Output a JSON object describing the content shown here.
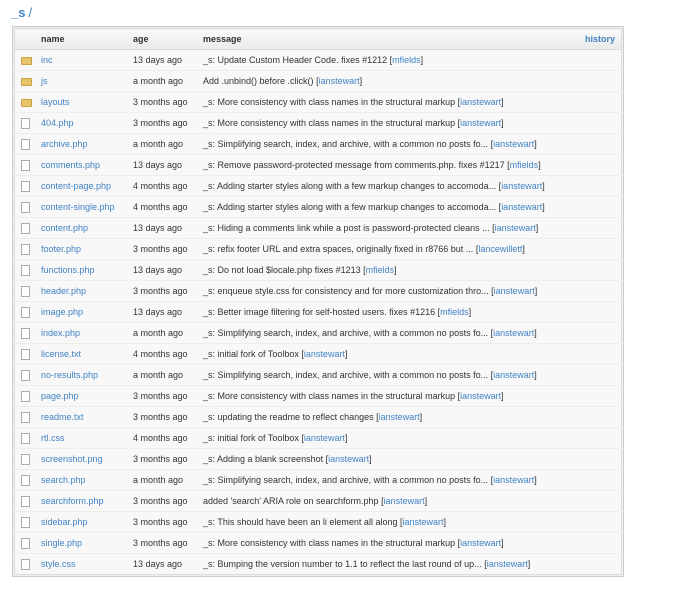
{
  "breadcrumb": {
    "repo": "_s",
    "sep": "/"
  },
  "header": {
    "name": "name",
    "age": "age",
    "message": "message",
    "history": "history"
  },
  "rows": [
    {
      "type": "folder",
      "name": "inc",
      "age": "13 days ago",
      "message": "_s: Update Custom Header Code. fixes #1212",
      "author": "mfields"
    },
    {
      "type": "folder",
      "name": "js",
      "age": "a month ago",
      "message": "Add .unbind() before .click()",
      "author": "ianstewart"
    },
    {
      "type": "folder",
      "name": "layouts",
      "age": "3 months ago",
      "message": "_s: More consistency with class names in the structural markup",
      "author": "ianstewart"
    },
    {
      "type": "file",
      "name": "404.php",
      "age": "3 months ago",
      "message": "_s: More consistency with class names in the structural markup",
      "author": "ianstewart"
    },
    {
      "type": "file",
      "name": "archive.php",
      "age": "a month ago",
      "message": "_s: Simplifying search, index, and archive, with a common no posts fo...",
      "author": "ianstewart"
    },
    {
      "type": "file",
      "name": "comments.php",
      "age": "13 days ago",
      "message": "_s: Remove password-protected message from comments.php. fixes #1217",
      "author": "mfields"
    },
    {
      "type": "file",
      "name": "content-page.php",
      "age": "4 months ago",
      "message": "_s: Adding starter styles along with a few markup changes to accomoda...",
      "author": "ianstewart"
    },
    {
      "type": "file",
      "name": "content-single.php",
      "age": "4 months ago",
      "message": "_s: Adding starter styles along with a few markup changes to accomoda...",
      "author": "ianstewart"
    },
    {
      "type": "file",
      "name": "content.php",
      "age": "13 days ago",
      "message": "_s: Hiding a comments link while a post is password-protected cleans ...",
      "author": "ianstewart"
    },
    {
      "type": "file",
      "name": "footer.php",
      "age": "3 months ago",
      "message": "_s: refix footer URL and extra spaces, originally fixed in r8766 but ...",
      "author": "lancewillett"
    },
    {
      "type": "file",
      "name": "functions.php",
      "age": "13 days ago",
      "message": "_s: Do not load $locale.php fixes #1213",
      "author": "mfields"
    },
    {
      "type": "file",
      "name": "header.php",
      "age": "3 months ago",
      "message": "_s: enqueue style.css for consistency and for more customization thro...",
      "author": "ianstewart"
    },
    {
      "type": "file",
      "name": "image.php",
      "age": "13 days ago",
      "message": "_s: Better image filtering for self-hosted users. fixes #1216",
      "author": "mfields"
    },
    {
      "type": "file",
      "name": "index.php",
      "age": "a month ago",
      "message": "_s: Simplifying search, index, and archive, with a common no posts fo...",
      "author": "ianstewart"
    },
    {
      "type": "file",
      "name": "license.txt",
      "age": "4 months ago",
      "message": "_s: initial fork of Toolbox",
      "author": "ianstewart"
    },
    {
      "type": "file",
      "name": "no-results.php",
      "age": "a month ago",
      "message": "_s: Simplifying search, index, and archive, with a common no posts fo...",
      "author": "ianstewart"
    },
    {
      "type": "file",
      "name": "page.php",
      "age": "3 months ago",
      "message": "_s: More consistency with class names in the structural markup",
      "author": "ianstewart"
    },
    {
      "type": "file",
      "name": "readme.txt",
      "age": "3 months ago",
      "message": "_s: updating the readme to reflect changes",
      "author": "ianstewart"
    },
    {
      "type": "file",
      "name": "rtl.css",
      "age": "4 months ago",
      "message": "_s: initial fork of Toolbox",
      "author": "ianstewart"
    },
    {
      "type": "file",
      "name": "screenshot.png",
      "age": "3 months ago",
      "message": "_s: Adding a blank screenshot",
      "author": "ianstewart"
    },
    {
      "type": "file",
      "name": "search.php",
      "age": "a month ago",
      "message": "_s: Simplifying search, index, and archive, with a common no posts fo...",
      "author": "ianstewart"
    },
    {
      "type": "file",
      "name": "searchform.php",
      "age": "3 months ago",
      "message": "added 'search' ARIA role on searchform.php",
      "author": "ianstewart"
    },
    {
      "type": "file",
      "name": "sidebar.php",
      "age": "3 months ago",
      "message": "_s: This should have been an li element all along",
      "author": "ianstewart"
    },
    {
      "type": "file",
      "name": "single.php",
      "age": "3 months ago",
      "message": "_s: More consistency with class names in the structural markup",
      "author": "ianstewart"
    },
    {
      "type": "file",
      "name": "style.css",
      "age": "13 days ago",
      "message": "_s: Bumping the version number to 1.1 to reflect the last round of up...",
      "author": "ianstewart"
    }
  ]
}
